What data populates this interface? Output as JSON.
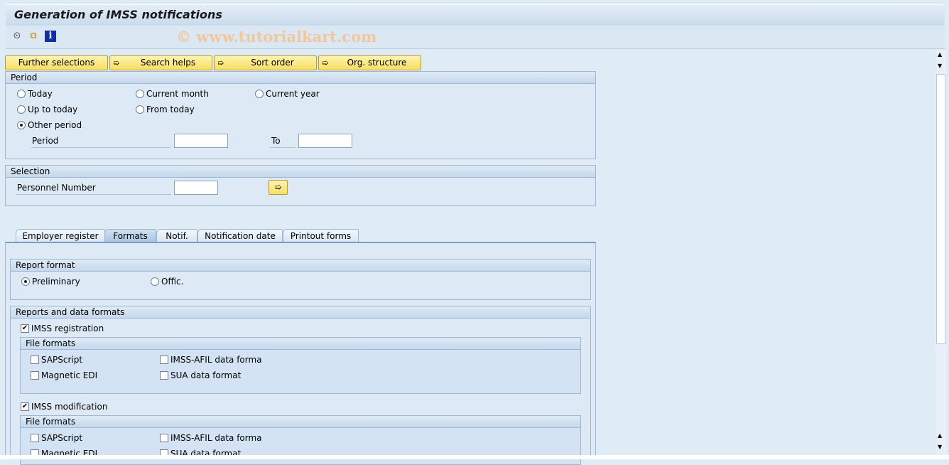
{
  "title": "Generation of IMSS notifications",
  "watermark": "© www.tutorialkart.com",
  "toolbar": {
    "icons": [
      "execute-clock-icon",
      "copy-variant-icon",
      "info-icon"
    ]
  },
  "buttons": [
    "Further selections",
    "Search helps",
    "Sort order",
    "Org. structure"
  ],
  "period": {
    "header": "Period",
    "options": [
      "Today",
      "Current month",
      "Current year",
      "Up to today",
      "From today",
      "Other period"
    ],
    "selected": "Other period",
    "period_label": "Period",
    "period_from": "",
    "to_label": "To",
    "period_to": ""
  },
  "selection": {
    "header": "Selection",
    "personnel_label": "Personnel Number",
    "personnel_value": ""
  },
  "tabs": [
    "Employer register",
    "Formats",
    "Notif.",
    "Notification date",
    "Printout forms"
  ],
  "active_tab": "Formats",
  "report_format": {
    "header": "Report format",
    "options": [
      "Preliminary",
      "Offic."
    ],
    "selected": "Preliminary"
  },
  "reports": {
    "header": "Reports and data formats",
    "registration": {
      "label": "IMSS registration",
      "checked": true,
      "file_header": "File formats",
      "items": [
        "SAPScript",
        "IMSS-AFIL data forma",
        "Magnetic EDI",
        "SUA data format"
      ]
    },
    "modification": {
      "label": "IMSS modification",
      "checked": true,
      "file_header": "File formats",
      "items": [
        "SAPScript",
        "IMSS-AFIL data forma",
        "Magnetic EDI",
        "SUA data format"
      ]
    }
  }
}
